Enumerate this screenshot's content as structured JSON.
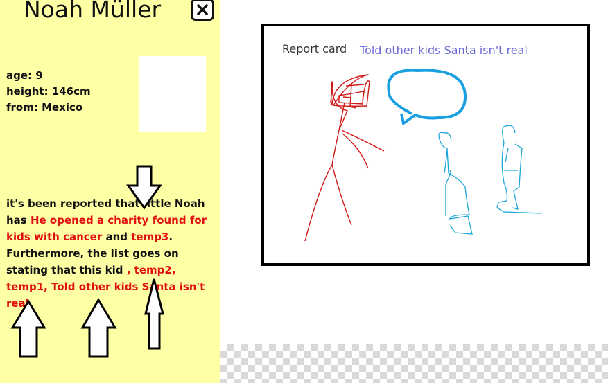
{
  "profile": {
    "name": "Noah Müller",
    "close_icon": "close-icon",
    "stats": {
      "age": "age: 9",
      "height": "height: 146cm",
      "from": "from: Mexico"
    }
  },
  "report": {
    "intro": "it's been reported that little Noah has ",
    "good_deed": "He opened a charity found for kids with cancer",
    "and": " and ",
    "temp3": "temp3",
    "middle": ". Furthermore, the list goes on stating that this kid ",
    "bad_deeds": ", temp2, temp1, Told other kids Santa isn't real"
  },
  "card": {
    "title": "Report card",
    "note": "Told other kids Santa isn't real"
  },
  "colors": {
    "panel": "#ffffa6",
    "deed_text": "#e01010",
    "note_text": "#6b6bd6",
    "santa_drawing": "#d01818",
    "kids_drawing": "#1aa6d8",
    "speech_bubble": "#1a9fe0"
  },
  "icons": [
    "close-icon",
    "arrow-down-icon",
    "arrow-up-icon"
  ]
}
